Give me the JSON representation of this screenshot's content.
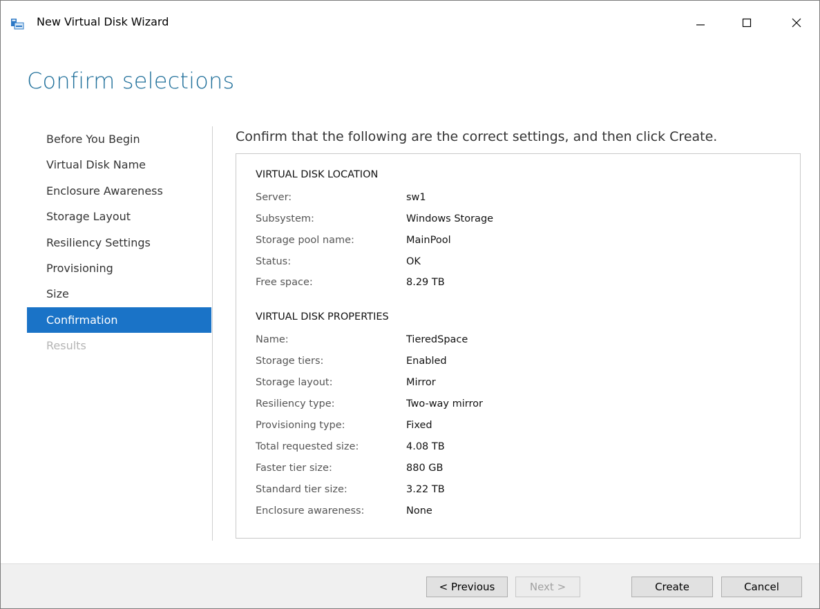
{
  "window": {
    "title": "New Virtual Disk Wizard",
    "icon": "virtual-disk-wizard-icon",
    "controls": [
      "minimize-icon",
      "maximize-icon",
      "close-icon"
    ]
  },
  "page": {
    "title": "Confirm selections",
    "instruction": "Confirm that the following are the correct settings, and then click Create."
  },
  "nav": {
    "items": [
      {
        "label": "Before You Begin",
        "state": "normal"
      },
      {
        "label": "Virtual Disk Name",
        "state": "normal"
      },
      {
        "label": "Enclosure Awareness",
        "state": "normal"
      },
      {
        "label": "Storage Layout",
        "state": "normal"
      },
      {
        "label": "Resiliency Settings",
        "state": "normal"
      },
      {
        "label": "Provisioning",
        "state": "normal"
      },
      {
        "label": "Size",
        "state": "normal"
      },
      {
        "label": "Confirmation",
        "state": "active"
      },
      {
        "label": "Results",
        "state": "disabled"
      }
    ]
  },
  "summary": {
    "location": {
      "heading": "VIRTUAL DISK LOCATION",
      "rows": [
        {
          "label": "Server:",
          "value": "sw1"
        },
        {
          "label": "Subsystem:",
          "value": "Windows Storage"
        },
        {
          "label": "Storage pool name:",
          "value": "MainPool"
        },
        {
          "label": "Status:",
          "value": "OK"
        },
        {
          "label": "Free space:",
          "value": "8.29 TB"
        }
      ]
    },
    "properties": {
      "heading": "VIRTUAL DISK PROPERTIES",
      "rows": [
        {
          "label": "Name:",
          "value": "TieredSpace"
        },
        {
          "label": "Storage tiers:",
          "value": "Enabled"
        },
        {
          "label": "Storage layout:",
          "value": "Mirror"
        },
        {
          "label": "Resiliency type:",
          "value": "Two-way mirror"
        },
        {
          "label": "Provisioning type:",
          "value": "Fixed"
        },
        {
          "label": "Total requested size:",
          "value": "4.08 TB"
        },
        {
          "label": "Faster tier size:",
          "value": "880 GB"
        },
        {
          "label": "Standard tier size:",
          "value": "3.22 TB"
        },
        {
          "label": "Enclosure awareness:",
          "value": "None"
        }
      ]
    }
  },
  "buttons": {
    "previous": "< Previous",
    "next": "Next >",
    "create": "Create",
    "cancel": "Cancel"
  },
  "colors": {
    "accent": "#1a73c7",
    "title": "#1f6f9a"
  }
}
